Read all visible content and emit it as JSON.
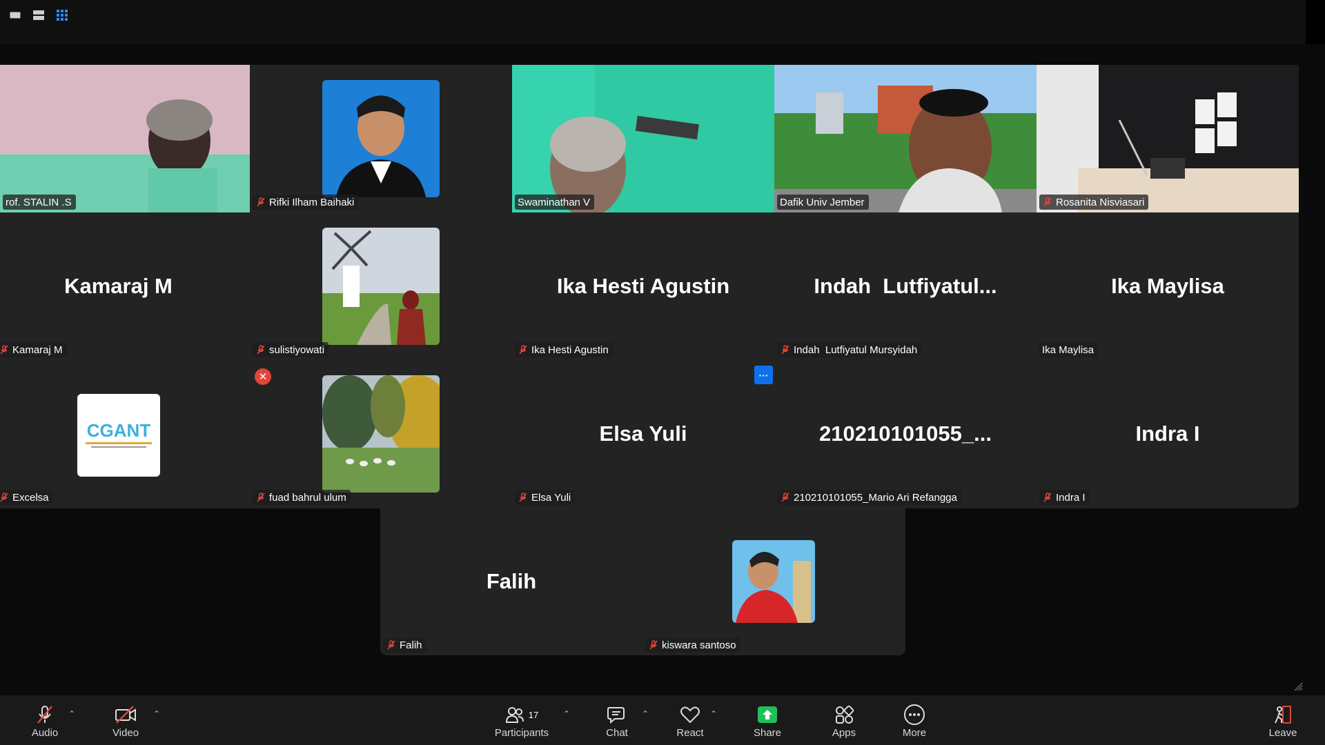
{
  "view_modes": [
    "speaker-view",
    "filmstrip-view",
    "gallery-view"
  ],
  "participants": [
    {
      "label": "rof. STALIN .S",
      "muted": false,
      "type": "video",
      "active": true
    },
    {
      "label": "Rifki Ilham Baihaki",
      "muted": true,
      "type": "photo"
    },
    {
      "label": "Swaminathan V",
      "muted": false,
      "type": "video"
    },
    {
      "label": "Dafik Univ Jember",
      "muted": false,
      "type": "video"
    },
    {
      "label": "Rosanita Nisviasari",
      "muted": true,
      "type": "video"
    },
    {
      "label": "Kamaraj M",
      "big": "Kamaraj M",
      "muted": true,
      "type": "name"
    },
    {
      "label": "sulistiyowati",
      "muted": true,
      "type": "photo"
    },
    {
      "label": "Ika Hesti Agustin",
      "big": "Ika Hesti Agustin",
      "muted": true,
      "type": "name"
    },
    {
      "label": "Indah  Lutfiyatul Mursyidah",
      "big": "Indah  Lutfiyatul...",
      "muted": true,
      "type": "name"
    },
    {
      "label": "Ika Maylisa",
      "big": "Ika Maylisa",
      "muted": false,
      "type": "name"
    },
    {
      "label": "Excelsa",
      "muted": true,
      "type": "photo"
    },
    {
      "label": "fuad bahrul ulum",
      "muted": true,
      "type": "photo"
    },
    {
      "label": "Elsa Yuli",
      "big": "Elsa Yuli",
      "muted": true,
      "type": "name"
    },
    {
      "label": "210210101055_Mario Ari Refangga",
      "big": "210210101055_...",
      "muted": true,
      "type": "name"
    },
    {
      "label": "Indra I",
      "big": "Indra I",
      "muted": true,
      "type": "name"
    },
    {
      "label": "Falih",
      "big": "Falih",
      "muted": true,
      "type": "name"
    },
    {
      "label": "kiswara santoso",
      "muted": true,
      "type": "photo"
    }
  ],
  "logo_text": "CGANT",
  "toolbar": {
    "audio": "Audio",
    "video": "Video",
    "participants": "Participants",
    "participants_count": "17",
    "chat": "Chat",
    "react": "React",
    "share": "Share",
    "apps": "Apps",
    "more": "More",
    "leave": "Leave"
  },
  "colors": {
    "active_speaker": "#31d67b",
    "share_green": "#1fc05a",
    "mute_red": "#e0463b",
    "more_blue": "#0e71eb",
    "gallery_bg": "#232323",
    "toolbar_bg": "#1a1a1a"
  }
}
